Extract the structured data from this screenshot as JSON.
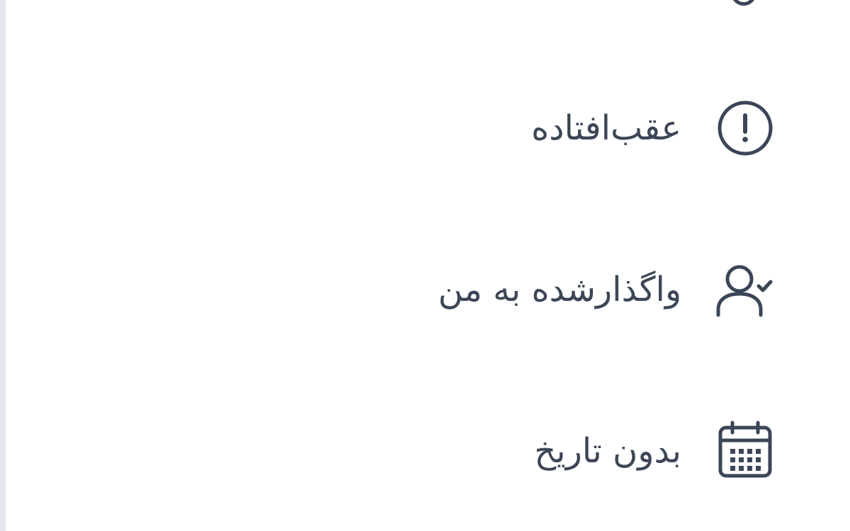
{
  "sidebar": {
    "items": [
      {
        "label": "عقب‌افتاده",
        "icon": "alert-circle-icon"
      },
      {
        "label": "واگذارشده به من",
        "icon": "user-check-icon"
      },
      {
        "label": "بدون تاریخ",
        "icon": "calendar-icon"
      }
    ]
  },
  "colors": {
    "text": "#3c4656",
    "icon": "#3a4657",
    "divider": "#e4e8ee",
    "background": "#ffffff"
  }
}
